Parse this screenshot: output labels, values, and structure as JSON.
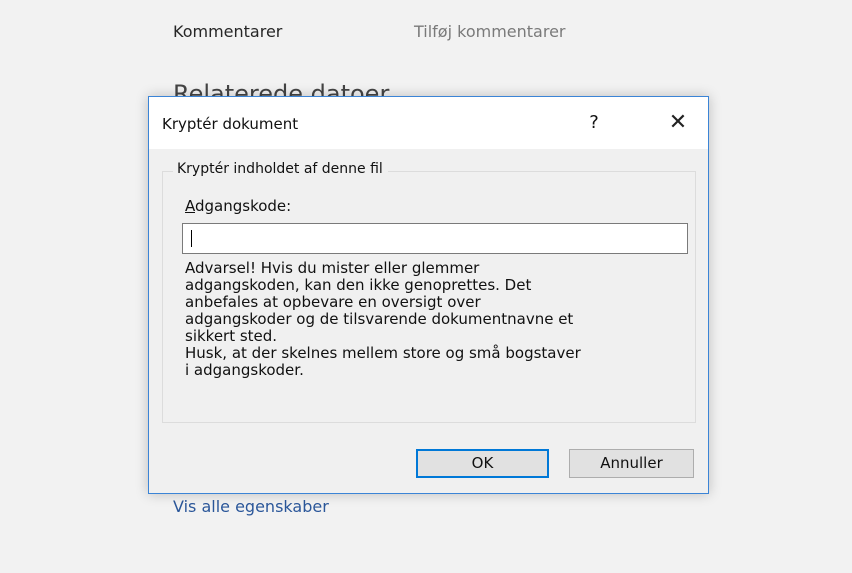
{
  "background": {
    "comments_label": "Kommentarer",
    "comments_value": "Tilføj kommentarer",
    "related_dates_heading": "Relaterede datoer",
    "show_all_link": "Vis alle egenskaber"
  },
  "dialog": {
    "title": "Kryptér dokument",
    "help_label": "?",
    "close_label": "✕",
    "group_title": "Kryptér indholdet af denne fil",
    "password_label_accel": "A",
    "password_label_rest": "dgangskode:",
    "password_value": "",
    "warning_lines": [
      "Advarsel! Hvis du mister eller glemmer",
      "adgangskoden, kan den ikke genoprettes. Det",
      "anbefales at opbevare en oversigt over",
      "adgangskoder og de tilsvarende dokumentnavne et",
      "sikkert sted.",
      "Husk, at der skelnes mellem store og små bogstaver",
      "i adgangskoder."
    ],
    "ok_label": "OK",
    "cancel_label": "Annuller"
  },
  "colors": {
    "dialog_border": "#3b84d6",
    "ok_focus_border": "#0078d7",
    "link": "#2b579a"
  }
}
